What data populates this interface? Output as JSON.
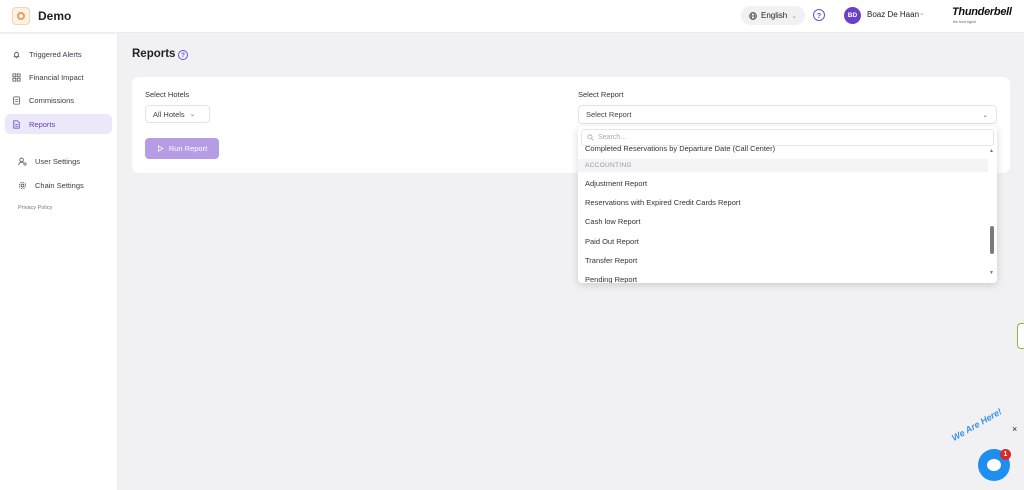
{
  "header": {
    "app_name": "Demo",
    "language": "English",
    "help_glyph": "?",
    "user_initials": "BD",
    "user_name": "Boaz De Haan",
    "brand_logo": "Thunderbell",
    "brand_tagline": "the front signal"
  },
  "sidebar": {
    "items": [
      {
        "label": "Triggered Alerts",
        "icon": "bell-icon"
      },
      {
        "label": "Financial Impact",
        "icon": "dashboard-icon"
      },
      {
        "label": "Commissions",
        "icon": "document-icon"
      },
      {
        "label": "Reports",
        "icon": "report-icon",
        "active": true
      },
      {
        "label": "User Settings",
        "icon": "user-settings-icon"
      },
      {
        "label": "Chain Settings",
        "icon": "gear-icon"
      }
    ],
    "privacy": "Privacy Policy"
  },
  "main": {
    "title": "Reports",
    "select_hotels_label": "Select Hotels",
    "hotels_value": "All Hotels",
    "select_report_label": "Select Report",
    "report_placeholder": "Select Report",
    "run_label": "Run Report"
  },
  "dropdown": {
    "search_placeholder": "Search...",
    "partial_top": "Completed Reservations by Departure Date (Call Center)",
    "group": "ACCOUNTING",
    "options": [
      "Adjustment Report",
      "Reservations with Expired Credit Cards Report",
      "Cash low Report",
      "Paid Out Report",
      "Transfer Report",
      "Pending Report"
    ]
  },
  "chat": {
    "badge_text": "We Are Here!",
    "count": "1",
    "close": "×"
  },
  "colors": {
    "accent": "#5b3fc4",
    "run_button": "#b59ce5",
    "chat": "#1f8ef1"
  }
}
